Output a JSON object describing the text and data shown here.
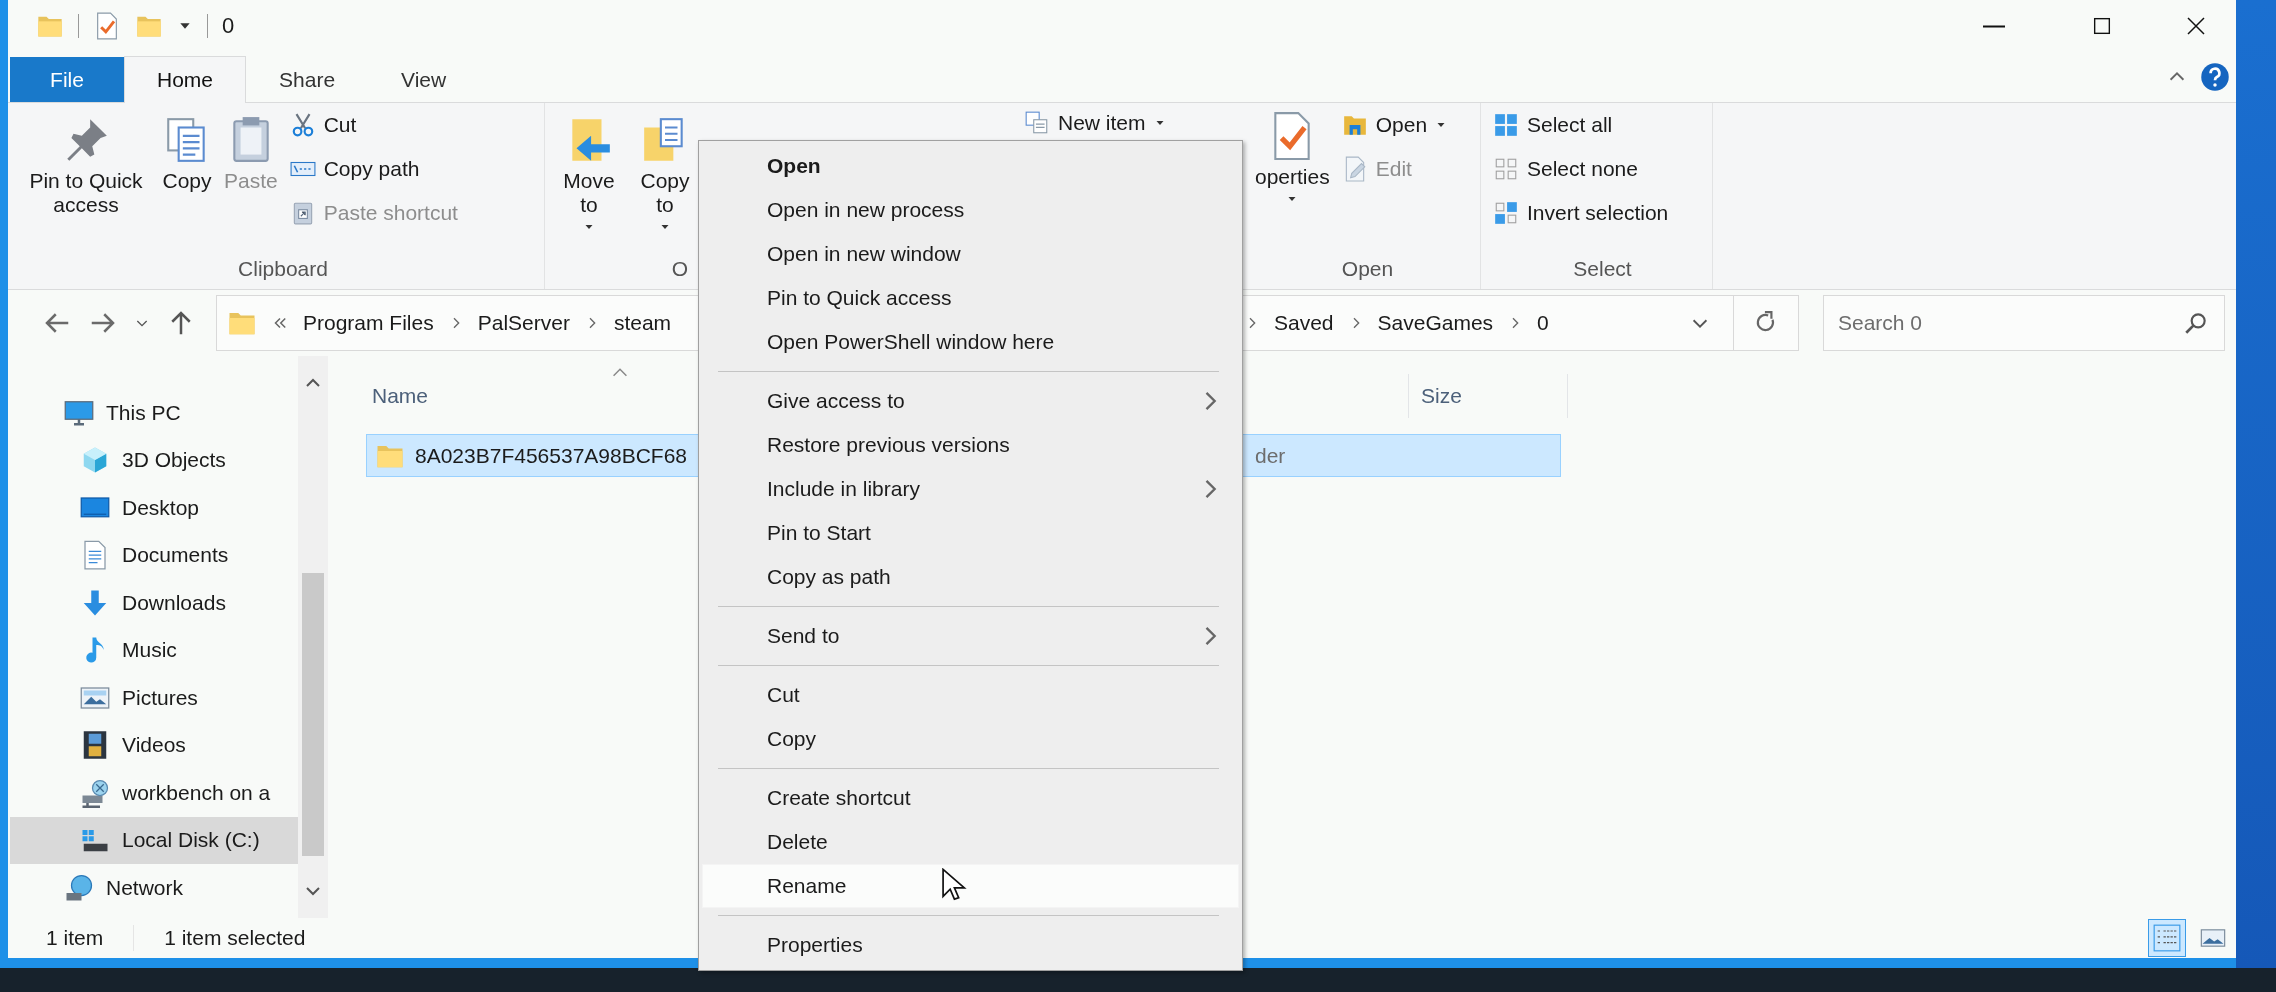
{
  "window": {
    "title": "0"
  },
  "tabs": [
    {
      "label": "File",
      "kind": "file_menu",
      "selected": false
    },
    {
      "label": "Home",
      "kind": "tab",
      "selected": true
    },
    {
      "label": "Share",
      "kind": "tab",
      "selected": false
    },
    {
      "label": "View",
      "kind": "tab",
      "selected": false
    }
  ],
  "ribbon": {
    "groups": [
      {
        "label": "Clipboard",
        "buttons": [
          {
            "label": "Pin to Quick access",
            "kind": "large",
            "disabled": false,
            "dropdown": false
          },
          {
            "label": "Copy",
            "kind": "large",
            "disabled": false,
            "dropdown": false
          },
          {
            "label": "Paste",
            "kind": "large",
            "disabled": true,
            "dropdown": false
          },
          {
            "label": "Cut",
            "kind": "small",
            "disabled": false,
            "dropdown": false
          },
          {
            "label": "Copy path",
            "kind": "small",
            "disabled": false,
            "dropdown": false
          },
          {
            "label": "Paste shortcut",
            "kind": "small",
            "disabled": true,
            "dropdown": false
          }
        ]
      },
      {
        "label": "O",
        "buttons": [
          {
            "label": "Move to",
            "kind": "large",
            "disabled": false,
            "dropdown": true
          },
          {
            "label": "Copy to",
            "kind": "large",
            "disabled": false,
            "dropdown": true
          }
        ]
      },
      {
        "buttons": [
          {
            "label": "New item",
            "kind": "small",
            "disabled": false,
            "dropdown": true
          }
        ]
      },
      {
        "label": "Open",
        "buttons": [
          {
            "label": "operties",
            "kind": "large",
            "disabled": false,
            "dropdown": true
          },
          {
            "label": "Open",
            "kind": "small",
            "disabled": false,
            "dropdown": true
          },
          {
            "label": "Edit",
            "kind": "small",
            "disabled": true,
            "dropdown": false
          }
        ]
      },
      {
        "label": "Select",
        "buttons": [
          {
            "label": "Select all",
            "kind": "small",
            "disabled": false,
            "dropdown": false
          },
          {
            "label": "Select none",
            "kind": "small",
            "disabled": false,
            "dropdown": false
          },
          {
            "label": "Invert selection",
            "kind": "small",
            "disabled": false,
            "dropdown": false
          }
        ]
      }
    ]
  },
  "address_bar": {
    "crumbs_start": [
      "Program Files",
      "PalServer",
      "steam"
    ],
    "crumbs_end": [
      "Saved",
      "SaveGames",
      "0"
    ]
  },
  "search": {
    "placeholder": "Search 0"
  },
  "navigation_pane": {
    "items": [
      {
        "label": "This PC",
        "selected": false,
        "children": [
          {
            "label": "3D Objects",
            "selected": false
          },
          {
            "label": "Desktop",
            "selected": false
          },
          {
            "label": "Documents",
            "selected": false
          },
          {
            "label": "Downloads",
            "selected": false
          },
          {
            "label": "Music",
            "selected": false
          },
          {
            "label": "Pictures",
            "selected": false
          },
          {
            "label": "Videos",
            "selected": false
          },
          {
            "label": "workbench on a",
            "selected": false
          },
          {
            "label": "Local Disk (C:)",
            "selected": true
          }
        ]
      },
      {
        "label": "Network",
        "selected": false
      }
    ]
  },
  "file_list": {
    "columns": [
      {
        "label": "Name",
        "sort_arrow": true
      },
      {
        "label": "Size",
        "sort_arrow": false
      }
    ],
    "rows": [
      {
        "name": "8A023B7F456537A98BCF68",
        "column_2": "der",
        "selected": true
      }
    ]
  },
  "status_bar": {
    "item_count": "1 item",
    "selection": "1 item selected",
    "view_buttons": [
      {
        "kind": "details",
        "selected": true
      },
      {
        "kind": "large_icons",
        "selected": false
      }
    ]
  },
  "context_menu": {
    "groups": [
      [
        {
          "label": "Open",
          "default": true,
          "submenu": false,
          "selected": false
        },
        {
          "label": "Open in new process",
          "default": false,
          "submenu": false,
          "selected": false
        },
        {
          "label": "Open in new window",
          "default": false,
          "submenu": false,
          "selected": false
        },
        {
          "label": "Pin to Quick access",
          "default": false,
          "submenu": false,
          "selected": false
        },
        {
          "label": "Open PowerShell window here",
          "default": false,
          "submenu": false,
          "selected": false
        }
      ],
      [
        {
          "label": "Give access to",
          "default": false,
          "submenu": true,
          "selected": false
        },
        {
          "label": "Restore previous versions",
          "default": false,
          "submenu": false,
          "selected": false
        },
        {
          "label": "Include in library",
          "default": false,
          "submenu": true,
          "selected": false
        },
        {
          "label": "Pin to Start",
          "default": false,
          "submenu": false,
          "selected": false
        },
        {
          "label": "Copy as path",
          "default": false,
          "submenu": false,
          "selected": false
        }
      ],
      [
        {
          "label": "Send to",
          "default": false,
          "submenu": true,
          "selected": false
        }
      ],
      [
        {
          "label": "Cut",
          "default": false,
          "submenu": false,
          "selected": false
        },
        {
          "label": "Copy",
          "default": false,
          "submenu": false,
          "selected": false
        }
      ],
      [
        {
          "label": "Create shortcut",
          "default": false,
          "submenu": false,
          "selected": false
        },
        {
          "label": "Delete",
          "default": false,
          "submenu": false,
          "selected": false
        },
        {
          "label": "Rename",
          "default": false,
          "submenu": false,
          "selected": true
        }
      ],
      [
        {
          "label": "Properties",
          "default": false,
          "submenu": false,
          "selected": false
        }
      ]
    ]
  }
}
